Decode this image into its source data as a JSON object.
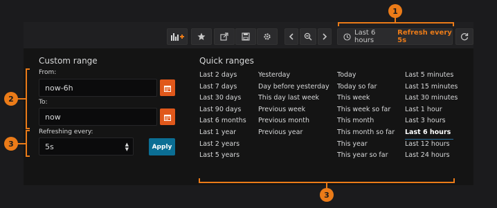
{
  "toolbar": {
    "icons": [
      "add-panel-icon",
      "star-icon",
      "share-icon",
      "save-icon",
      "gear-icon",
      "chevron-left-icon",
      "zoom-out-icon",
      "chevron-right-icon",
      "clock-icon",
      "refresh-icon"
    ],
    "time_range_label": "Last 6 hours",
    "refresh_label": "Refresh every 5s"
  },
  "custom_range": {
    "title": "Custom range",
    "from_label": "From:",
    "from_value": "now-6h",
    "to_label": "To:",
    "to_value": "now",
    "refreshing_label": "Refreshing every:",
    "refreshing_value": "5s",
    "apply_label": "Apply"
  },
  "quick_ranges": {
    "title": "Quick ranges",
    "columns": [
      [
        "Last 2 days",
        "Last 7 days",
        "Last 30 days",
        "Last 90 days",
        "Last 6 months",
        "Last 1 year",
        "Last 2 years",
        "Last 5 years"
      ],
      [
        "Yesterday",
        "Day before yesterday",
        "This day last week",
        "Previous week",
        "Previous month",
        "Previous year"
      ],
      [
        "Today",
        "Today so far",
        "This week",
        "This week so far",
        "This month",
        "This month so far",
        "This year",
        "This year so far"
      ],
      [
        "Last 5 minutes",
        "Last 15 minutes",
        "Last 30 minutes",
        "Last 1 hour",
        "Last 3 hours",
        "Last 6 hours",
        "Last 12 hours",
        "Last 24 hours"
      ]
    ],
    "active": "Last 6 hours"
  },
  "annotations": {
    "badge_1": "1",
    "badge_2": "2",
    "badge_3a": "3",
    "badge_3b": "3"
  },
  "colors": {
    "accent": "#eb7b18",
    "calendar_button": "#e0581b",
    "apply_button": "#0b6e94",
    "background": "#1b1b1d",
    "panel": "#141414"
  }
}
